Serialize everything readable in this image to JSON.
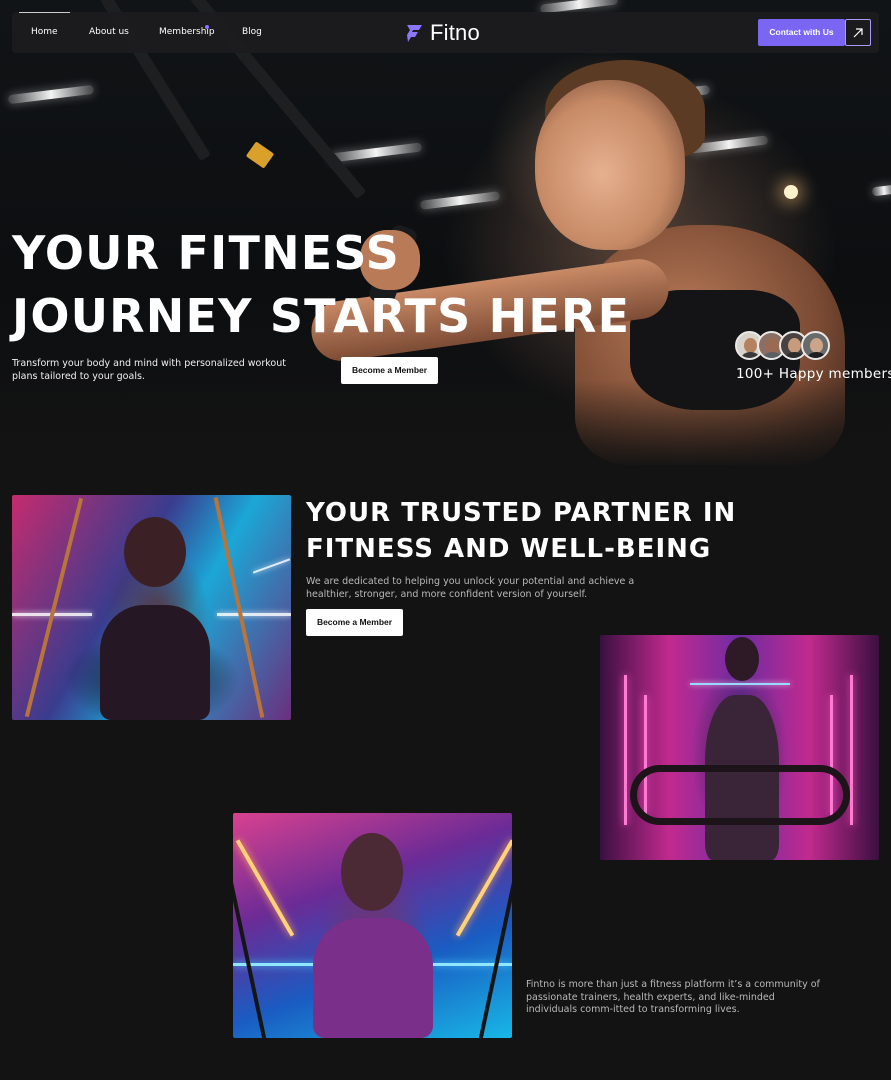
{
  "nav": {
    "items": [
      {
        "label": "Home",
        "active": true
      },
      {
        "label": "About us",
        "active": false
      },
      {
        "label": "Membership",
        "active": false,
        "indicator": true
      },
      {
        "label": "Blog",
        "active": false
      }
    ],
    "logo_text": "Fitno",
    "logo_icon": "bolt-f-icon",
    "contact_label": "Contact with Us",
    "contact_icon": "arrow-up-right-icon"
  },
  "hero": {
    "title_line1": "YOUR FITNESS",
    "title_line2": "JOURNEY STARTS HERE",
    "subtitle": "Transform your body and mind with personalized workout plans tailored to your goals.",
    "cta_label": "Become a Member",
    "members_text": "100+ Happy members",
    "avatar_count": 4
  },
  "about": {
    "title_line1": "YOUR TRUSTED PARTNER IN",
    "title_line2": "FITNESS AND WELL-BEING",
    "subtitle": "We are dedicated to helping you unlock your potential and achieve a healthier, stronger, and more confident version of yourself.",
    "cta_label": "Become a Member",
    "community_text": "Fintno is more than just a fitness platform it’s a community of passionate trainers, health experts, and like-minded individuals comm-itted to transforming lives."
  },
  "colors": {
    "accent": "#7a66f2",
    "background": "#131313",
    "nav_background": "#1c1c1e",
    "muted_text": "#b9b9b9"
  }
}
